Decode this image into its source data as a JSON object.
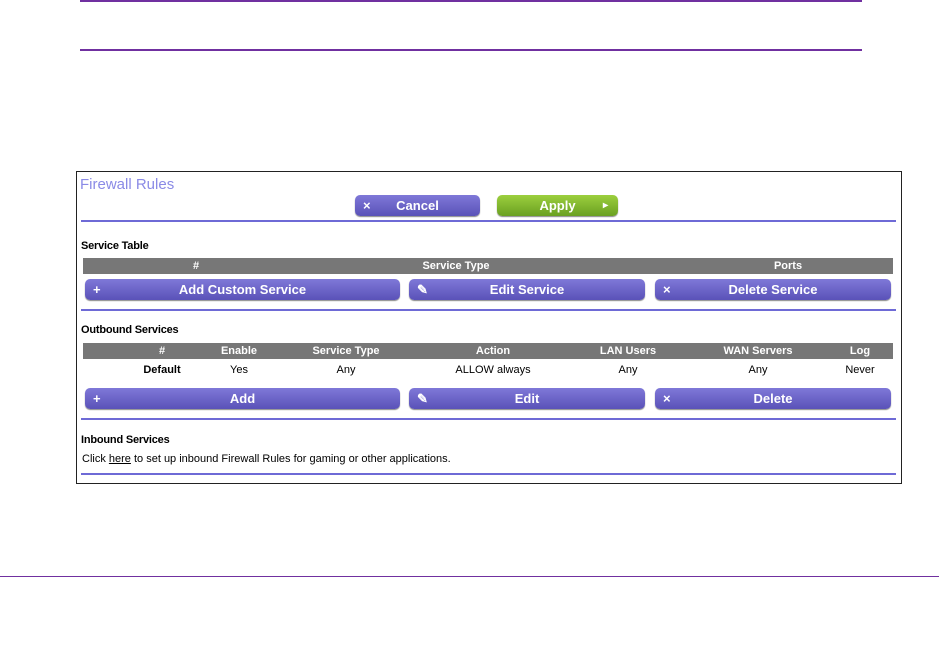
{
  "panel": {
    "title": "Firewall Rules",
    "cancel": "Cancel",
    "apply": "Apply"
  },
  "service_table": {
    "heading": "Service Table",
    "columns": [
      "#",
      "Service Type",
      "Ports"
    ],
    "buttons": {
      "add": "Add Custom Service",
      "edit": "Edit Service",
      "delete": "Delete Service"
    }
  },
  "outbound": {
    "heading": "Outbound Services",
    "columns": [
      "#",
      "Enable",
      "Service Type",
      "Action",
      "LAN Users",
      "WAN Servers",
      "Log"
    ],
    "rows": [
      [
        "Default",
        "Yes",
        "Any",
        "ALLOW always",
        "Any",
        "Any",
        "Never"
      ]
    ],
    "buttons": {
      "add": "Add",
      "edit": "Edit",
      "delete": "Delete"
    }
  },
  "inbound": {
    "heading": "Inbound Services",
    "pre": "Click ",
    "link": "here",
    "post": " to set up inbound Firewall Rules for gaming or other applications."
  },
  "icons": {
    "x": "×",
    "plus": "+",
    "pencil": "✎",
    "arrow": "▸"
  }
}
